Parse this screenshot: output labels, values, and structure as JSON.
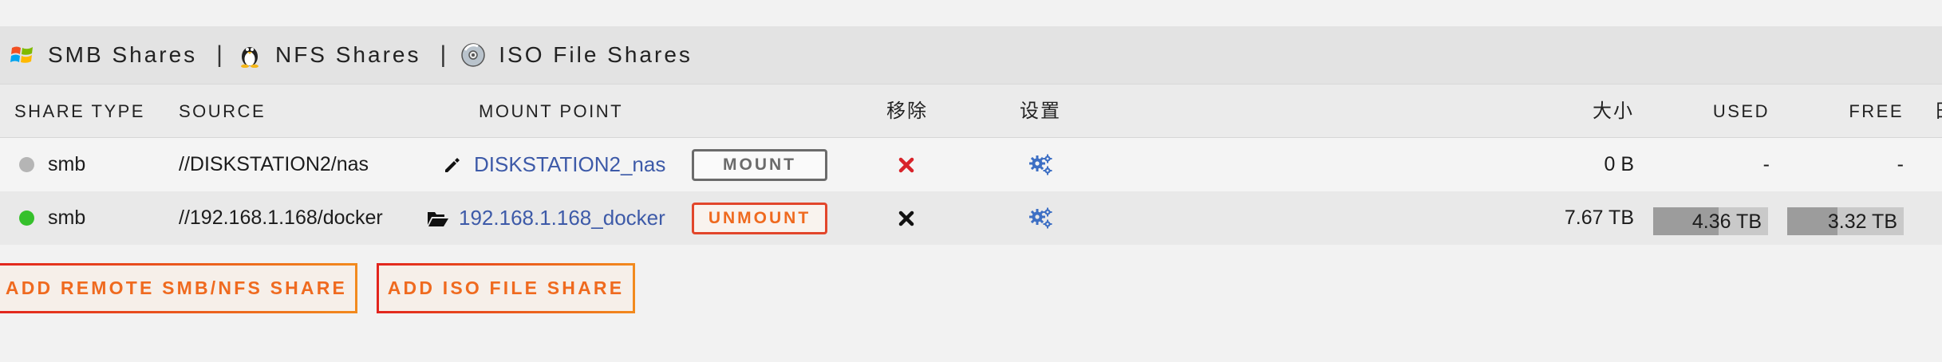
{
  "tabs": [
    {
      "label": "SMB Shares",
      "icon": "windows-logo-icon"
    },
    {
      "label": "NFS Shares",
      "icon": "linux-tux-icon"
    },
    {
      "label": "ISO File Shares",
      "icon": "disc-icon"
    }
  ],
  "separator": "|",
  "columns": {
    "share_type": "SHARE TYPE",
    "source": "SOURCE",
    "mount_point": "MOUNT POINT",
    "remove": "移除",
    "settings": "设置",
    "size": "大小",
    "used": "USED",
    "free": "FREE",
    "cut_off": "日"
  },
  "rows": [
    {
      "status_color": "#b5b5b5",
      "type": "smb",
      "source": "//DISKSTATION2/nas",
      "mount_icon": "pencil-icon",
      "mount_point": "DISKSTATION2_nas",
      "action_label": "MOUNT",
      "remove_color": "#d8232a",
      "size": "0 B",
      "used": "-",
      "free": "-"
    },
    {
      "status_color": "#35c02b",
      "type": "smb",
      "source": "//192.168.1.168/docker",
      "mount_icon": "folder-open-icon",
      "mount_point": "192.168.1.168_docker",
      "action_label": "UNMOUNT",
      "remove_color": "#111111",
      "size": "7.67 TB",
      "used": "4.36 TB",
      "used_fraction": 0.57,
      "free": "3.32 TB",
      "free_fraction": 0.43
    }
  ],
  "buttons": {
    "add_remote": "ADD REMOTE SMB/NFS SHARE",
    "add_iso": "ADD ISO FILE SHARE"
  },
  "colors": {
    "link": "#3d5aa8",
    "accent_orange": "#ef6a1f",
    "accent_red": "#e2251e",
    "gear_blue": "#3d6fc4"
  }
}
